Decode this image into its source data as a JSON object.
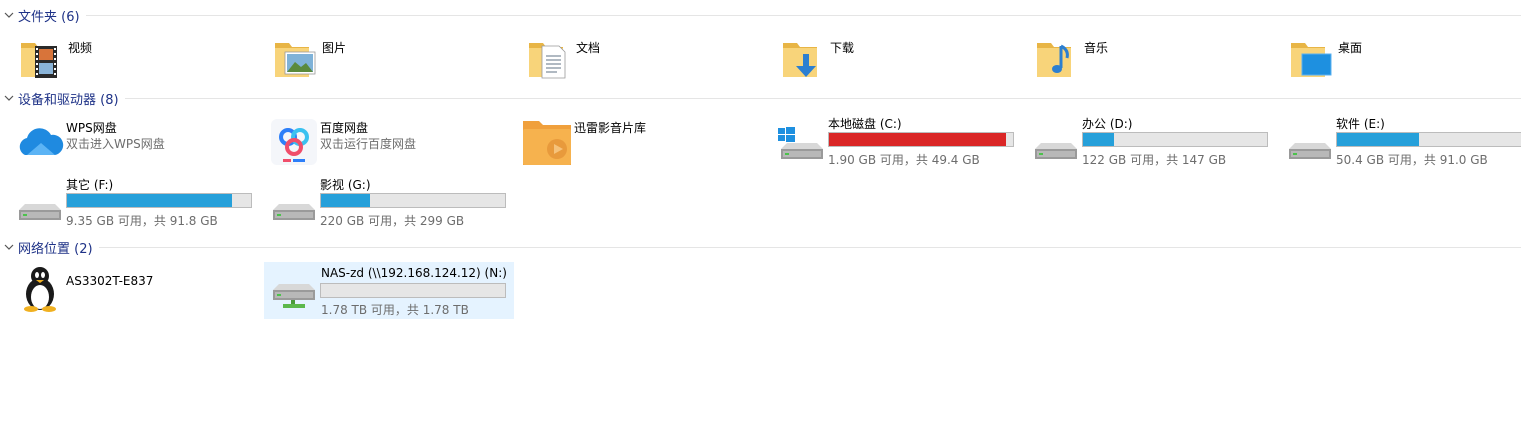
{
  "colors": {
    "accent": "#26a0da",
    "critical": "#da2626",
    "header_text": "#1e3287",
    "selection": "#e5f3ff"
  },
  "groups": {
    "folders": {
      "title": "文件夹 (6)"
    },
    "devices": {
      "title": "设备和驱动器 (8)"
    },
    "network": {
      "title": "网络位置 (2)"
    }
  },
  "folders": [
    {
      "name": "视频",
      "icon": "video-folder-icon"
    },
    {
      "name": "图片",
      "icon": "pictures-folder-icon"
    },
    {
      "name": "文档",
      "icon": "documents-folder-icon"
    },
    {
      "name": "下载",
      "icon": "downloads-folder-icon"
    },
    {
      "name": "音乐",
      "icon": "music-folder-icon"
    },
    {
      "name": "桌面",
      "icon": "desktop-folder-icon"
    }
  ],
  "apps": [
    {
      "name": "WPS网盘",
      "sub": "双击进入WPS网盘",
      "icon": "wps-cloud-icon"
    },
    {
      "name": "百度网盘",
      "sub": "双击运行百度网盘",
      "icon": "baidu-netdisk-icon"
    },
    {
      "name": "迅雷影音片库",
      "sub": "",
      "icon": "xunlei-media-folder-icon"
    }
  ],
  "drives": [
    {
      "name": "本地磁盘 (C:)",
      "space": "1.90 GB 可用，共 49.4 GB",
      "used_fraction": 0.962,
      "low": true,
      "icon": "windows-drive-icon"
    },
    {
      "name": "办公 (D:)",
      "space": "122 GB 可用，共 147 GB",
      "used_fraction": 0.17,
      "low": false,
      "icon": "hard-drive-icon"
    },
    {
      "name": "软件 (E:)",
      "space": "50.4 GB 可用，共 91.0 GB",
      "used_fraction": 0.446,
      "low": false,
      "icon": "hard-drive-icon"
    },
    {
      "name": "其它 (F:)",
      "space": "9.35 GB 可用，共 91.8 GB",
      "used_fraction": 0.898,
      "low": false,
      "icon": "hard-drive-icon"
    },
    {
      "name": "影视 (G:)",
      "space": "220 GB 可用，共 299 GB",
      "used_fraction": 0.264,
      "low": false,
      "icon": "hard-drive-icon"
    }
  ],
  "network": [
    {
      "name": "AS3302T-E837",
      "icon": "linux-tux-icon"
    },
    {
      "name": "NAS-zd (\\\\192.168.124.12) (N:)",
      "space": "1.78 TB 可用，共 1.78 TB",
      "used_fraction": 0.0,
      "icon": "network-drive-icon",
      "selected": true
    }
  ]
}
